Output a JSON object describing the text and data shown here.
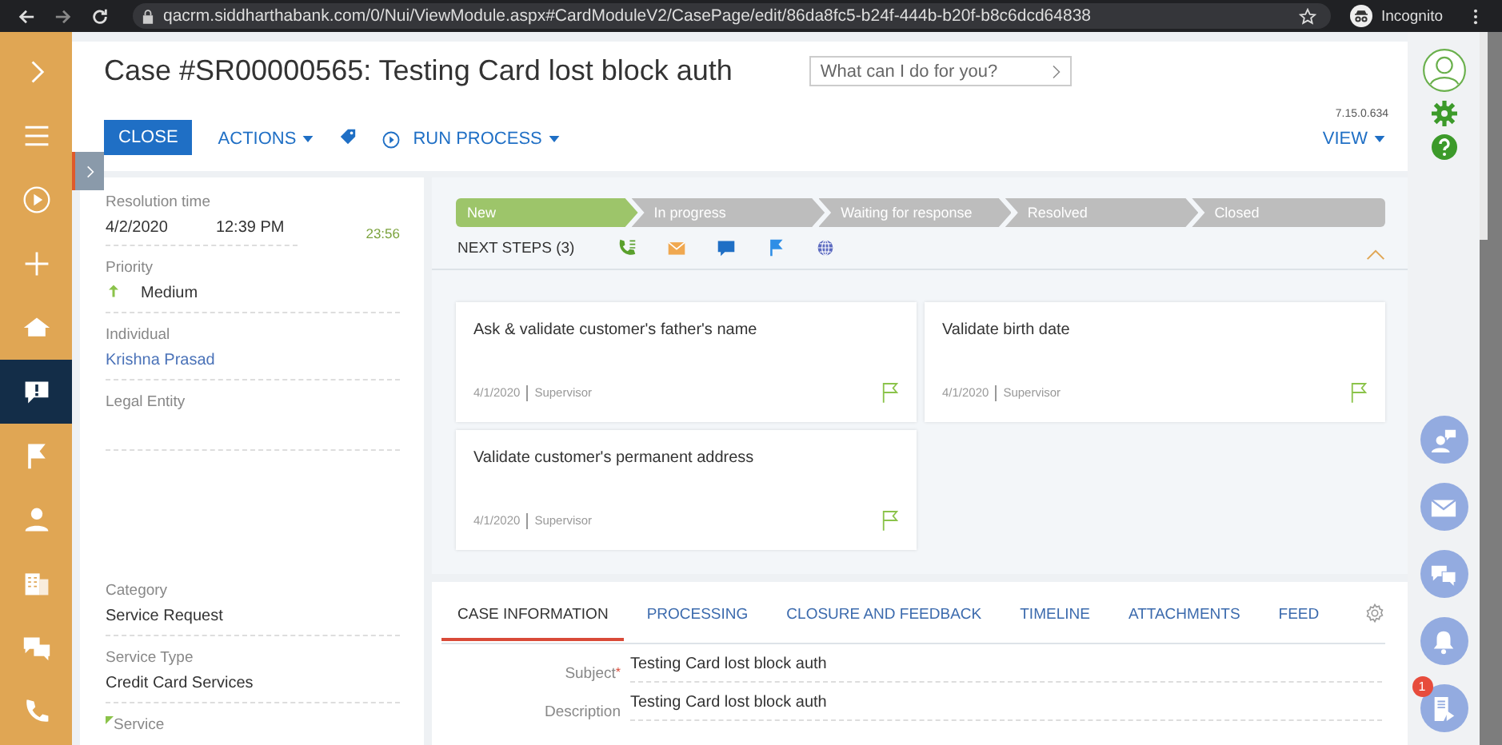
{
  "browser": {
    "url": "qacrm.siddharthabank.com/0/Nui/ViewModule.aspx#CardModuleV2/CasePage/edit/86da8fc5-b24f-444b-b20f-b8c6dcd64838",
    "profile": "Incognito"
  },
  "nav_items": [
    {
      "selected": false
    },
    {
      "selected": false
    },
    {
      "selected": false
    },
    {
      "selected": false
    },
    {
      "selected": false
    },
    {
      "selected": true
    },
    {
      "selected": false
    },
    {
      "selected": false
    },
    {
      "selected": false
    },
    {
      "selected": false
    },
    {
      "selected": false
    }
  ],
  "header": {
    "title": "Case #SR00000565: Testing Card lost block auth",
    "search": {
      "placeholder": "What can I do for you?"
    },
    "version": "7.15.0.634",
    "close_button": "CLOSE",
    "actions_button": "ACTIONS",
    "run_process_button": "RUN PROCESS",
    "view_button": "VIEW"
  },
  "left_panel": {
    "resolution_time": {
      "label": "Resolution time",
      "date": "4/2/2020",
      "time": "12:39 PM",
      "remaining": "23:56"
    },
    "fields": [
      {
        "label": "Priority",
        "value": "Medium",
        "kind": "priority"
      },
      {
        "label": "Individual",
        "value": "Krishna Prasad",
        "kind": "link"
      },
      {
        "label": "Legal Entity",
        "kind": "tall"
      },
      {
        "label": "Category",
        "value": "Service Request",
        "kind": "text"
      },
      {
        "label": "Service Type",
        "value": "Credit Card Services",
        "kind": "text"
      },
      {
        "label": "Service",
        "kind": "marker"
      }
    ]
  },
  "stages": [
    {
      "label": "New",
      "selected": true
    },
    {
      "label": "In progress",
      "selected": false
    },
    {
      "label": "Waiting for response",
      "selected": false
    },
    {
      "label": "Resolved",
      "selected": false
    },
    {
      "label": "Closed",
      "selected": false
    }
  ],
  "next_steps": {
    "title": "NEXT STEPS (3)",
    "cards": [
      {
        "title": "Ask & validate customer's father's name",
        "date": "4/1/2020",
        "owner": "Supervisor"
      },
      {
        "title": "Validate birth date",
        "date": "4/1/2020",
        "owner": "Supervisor"
      },
      {
        "title": "Validate customer's permanent address",
        "date": "4/1/2020",
        "owner": "Supervisor"
      }
    ]
  },
  "tabs": [
    {
      "label": "CASE INFORMATION",
      "selected": true
    },
    {
      "label": "PROCESSING",
      "selected": false
    },
    {
      "label": "CLOSURE AND FEEDBACK",
      "selected": false
    },
    {
      "label": "TIMELINE",
      "selected": false
    },
    {
      "label": "ATTACHMENTS",
      "selected": false
    },
    {
      "label": "FEED",
      "selected": false
    }
  ],
  "case_fields": [
    {
      "label": "Subject",
      "value": "Testing Card lost block auth",
      "required_mark": "*"
    },
    {
      "label": "Description",
      "value": "Testing Card lost block auth"
    }
  ],
  "right_rail": {
    "notification_badge": "1"
  }
}
